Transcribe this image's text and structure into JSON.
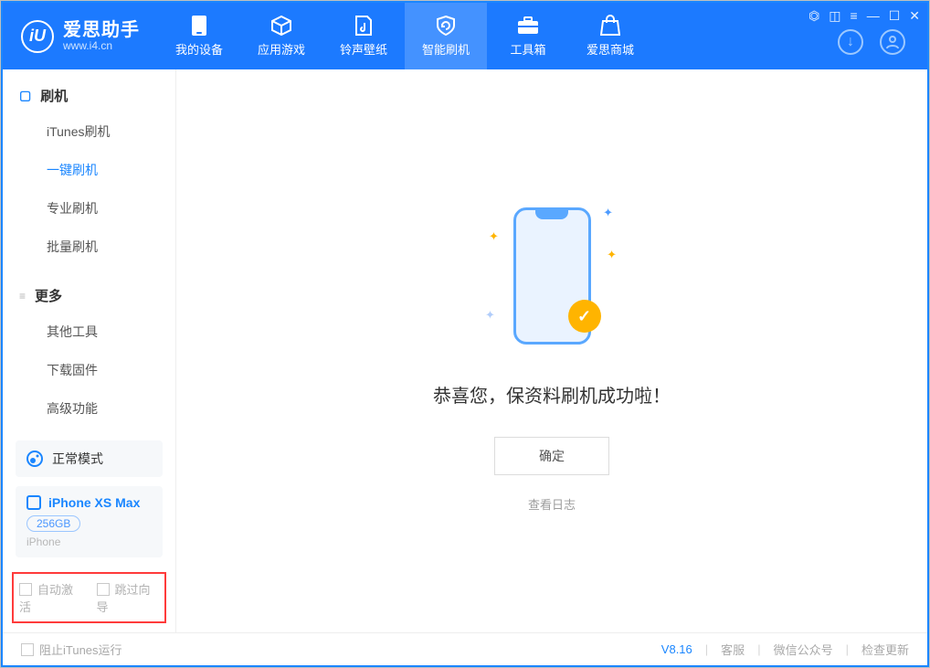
{
  "header": {
    "app_name": "爱思助手",
    "app_domain": "www.i4.cn",
    "nav": [
      {
        "label": "我的设备"
      },
      {
        "label": "应用游戏"
      },
      {
        "label": "铃声壁纸"
      },
      {
        "label": "智能刷机"
      },
      {
        "label": "工具箱"
      },
      {
        "label": "爱思商城"
      }
    ]
  },
  "sidebar": {
    "section1_title": "刷机",
    "items1": [
      {
        "label": "iTunes刷机"
      },
      {
        "label": "一键刷机"
      },
      {
        "label": "专业刷机"
      },
      {
        "label": "批量刷机"
      }
    ],
    "section2_title": "更多",
    "items2": [
      {
        "label": "其他工具"
      },
      {
        "label": "下载固件"
      },
      {
        "label": "高级功能"
      }
    ],
    "mode_label": "正常模式",
    "device_name": "iPhone XS Max",
    "device_storage": "256GB",
    "device_type": "iPhone",
    "check_auto_activate": "自动激活",
    "check_skip_guide": "跳过向导"
  },
  "main": {
    "success_text": "恭喜您，保资料刷机成功啦！",
    "ok_button": "确定",
    "view_log": "查看日志"
  },
  "footer": {
    "block_itunes": "阻止iTunes运行",
    "version": "V8.16",
    "support": "客服",
    "wechat": "微信公众号",
    "check_update": "检查更新"
  }
}
